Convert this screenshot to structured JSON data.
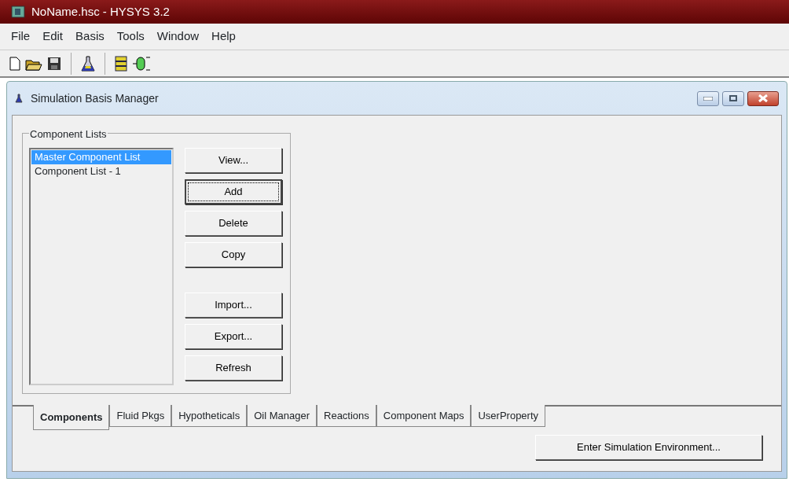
{
  "window": {
    "title": "NoName.hsc - HYSYS 3.2"
  },
  "menu": [
    "File",
    "Edit",
    "Basis",
    "Tools",
    "Window",
    "Help"
  ],
  "child_window": {
    "title": "Simulation Basis Manager"
  },
  "component_lists": {
    "label": "Component Lists",
    "items": [
      {
        "label": "Master Component List",
        "selected": true
      },
      {
        "label": "Component List - 1",
        "selected": false
      }
    ],
    "buttons": [
      {
        "label": "View...",
        "focused": false
      },
      {
        "label": "Add",
        "focused": true
      },
      {
        "label": "Delete",
        "focused": false
      },
      {
        "label": "Copy",
        "focused": false
      },
      {
        "label": "Import...",
        "focused": false
      },
      {
        "label": "Export...",
        "focused": false
      },
      {
        "label": "Refresh",
        "focused": false
      }
    ]
  },
  "tabs": [
    {
      "label": "Components",
      "selected": true
    },
    {
      "label": "Fluid Pkgs",
      "selected": false
    },
    {
      "label": "Hypotheticals",
      "selected": false
    },
    {
      "label": "Oil Manager",
      "selected": false
    },
    {
      "label": "Reactions",
      "selected": false
    },
    {
      "label": "Component Maps",
      "selected": false
    },
    {
      "label": "UserProperty",
      "selected": false
    }
  ],
  "enter_button": "Enter Simulation Environment..."
}
